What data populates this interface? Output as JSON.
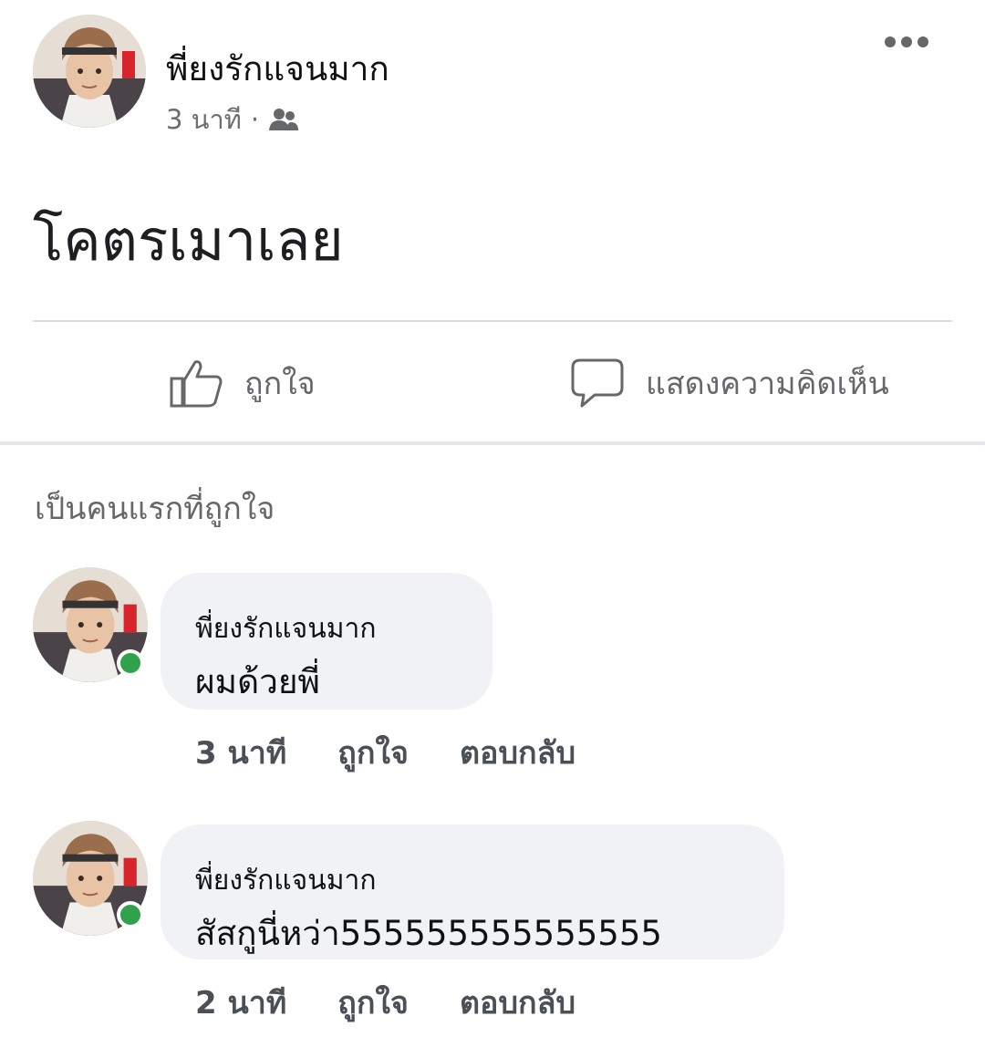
{
  "post": {
    "author": "พี่ยงรักแจนมาก",
    "time": "3 นาที",
    "separator": "·",
    "audience_icon": "friends-icon",
    "text": "โคตรเมาเลย",
    "more_icon": "more-horizontal-icon"
  },
  "actions": {
    "like_label": "ถูกใจ",
    "like_icon": "thumbs-up-icon",
    "comment_label": "แสดงความคิดเห็น",
    "comment_icon": "comment-bubble-icon"
  },
  "first_like_text": "เป็นคนแรกที่ถูกใจ",
  "comments": [
    {
      "author": "พี่ยงรักแจนมาก",
      "text": "ผมด้วยพี่",
      "time": "3 นาที",
      "like_label": "ถูกใจ",
      "reply_label": "ตอบกลับ"
    },
    {
      "author": "พี่ยงรักแจนมาก",
      "text": "สัสกูนี่หว่า555555555555555",
      "time": "2 นาที",
      "like_label": "ถูกใจ",
      "reply_label": "ตอบกลับ"
    }
  ],
  "colors": {
    "online": "#31a24c",
    "secondary_text": "#65676b",
    "bubble": "#f0f2f5"
  }
}
